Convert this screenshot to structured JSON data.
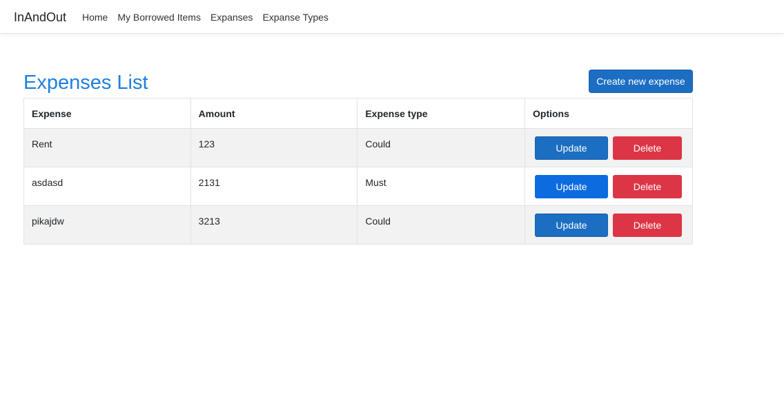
{
  "navbar": {
    "brand": "InAndOut",
    "links": [
      {
        "label": "Home"
      },
      {
        "label": "My Borrowed Items"
      },
      {
        "label": "Expanses"
      },
      {
        "label": "Expanse Types"
      }
    ]
  },
  "main": {
    "title": "Expenses List",
    "create_label": "Create new expense",
    "table": {
      "headers": [
        "Expense",
        "Amount",
        "Expense type",
        "Options"
      ],
      "rows": [
        {
          "expense": "Rent",
          "amount": "123",
          "type": "Could"
        },
        {
          "expense": "asdasd",
          "amount": "2131",
          "type": "Must"
        },
        {
          "expense": "pikajdw",
          "amount": "3213",
          "type": "Could"
        }
      ],
      "update_label": "Update",
      "delete_label": "Delete"
    }
  },
  "colors": {
    "primary": "#1b6ec2",
    "danger": "#dc3545",
    "title": "#1e7fe0"
  }
}
